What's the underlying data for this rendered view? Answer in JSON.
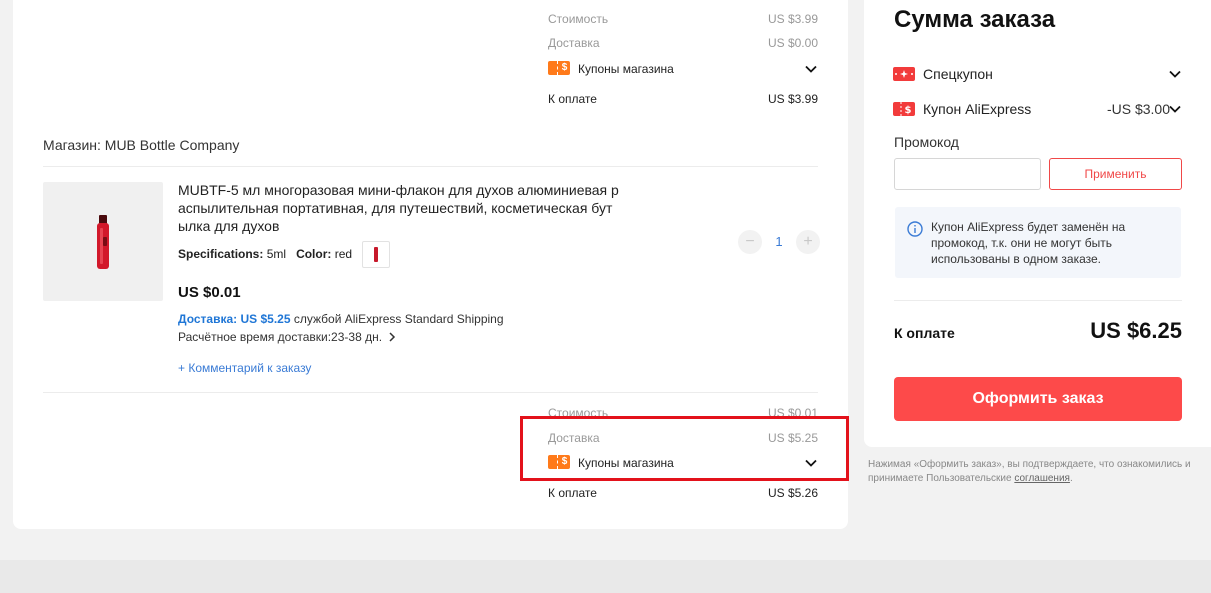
{
  "store1": {
    "cost_label": "Стоимость",
    "cost_value": "US $3.99",
    "delivery_label": "Доставка",
    "delivery_value": "US $0.00",
    "coupon_label": "Купоны магазина",
    "pay_label": "К оплате",
    "pay_value": "US $3.99"
  },
  "store2": {
    "name": "Магазин: MUB Bottle Company",
    "product": {
      "title": "MUBTF-5 мл многоразовая мини-флакон для духов алюминиевая р аспылительная портативная, для путешествий, косметическая бут ылка для духов",
      "spec_label": "Specifications:",
      "spec_value": "5ml",
      "color_label": "Color:",
      "color_value": "red",
      "price": "US $0.01",
      "shipping_cost": "Доставка: US $5.25",
      "shipping_service": "службой AliExpress Standard Shipping",
      "eta": "Расчётное время доставки:23-38 дн.",
      "comment": "+ Комментарий к заказу",
      "quantity": "1",
      "minus": "−",
      "plus": "+"
    },
    "cost_label": "Стоимость",
    "cost_value": "US $0.01",
    "delivery_label": "Доставка",
    "delivery_value": "US $5.25",
    "coupon_label": "Купоны магазина",
    "pay_label": "К оплате",
    "pay_value": "US $5.26"
  },
  "summary": {
    "title": "Сумма заказа",
    "special_coupon": "Спецкупон",
    "ae_coupon": "Купон AliExpress",
    "ae_coupon_value": "-US $3.00",
    "promo_label": "Промокод",
    "promo_placeholder": "",
    "apply": "Применить",
    "notice": "Купон AliExpress будет заменён на промокод, т.к. они не могут быть использованы в одном заказе.",
    "total_label": "К оплате",
    "total_value": "US $6.25",
    "checkout": "Оформить заказ",
    "legal_text": "Нажимая «Оформить заказ», вы подтверждаете, что ознакомились и принимаете Пользовательские ",
    "legal_link": "соглашения",
    "legal_end": "."
  },
  "colors": {
    "accent": "#fd4a4a",
    "coupon": "#ff7a1a",
    "link": "#3a7bd5",
    "highlight": "#e3121b"
  }
}
